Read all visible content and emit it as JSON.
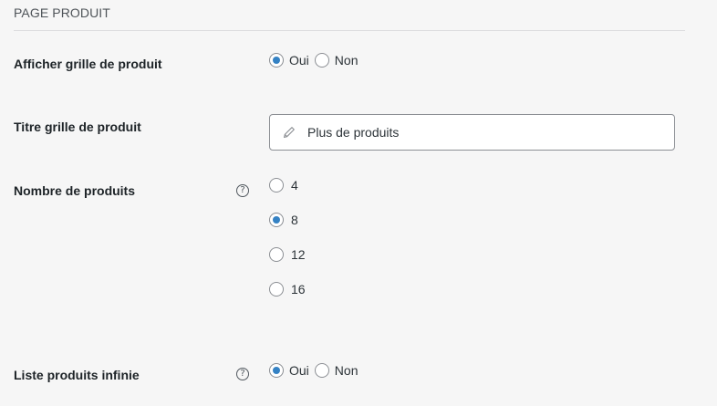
{
  "section": {
    "title": "PAGE PRODUIT"
  },
  "rows": {
    "show_grid": {
      "label": "Afficher grille de produit",
      "options": [
        "Oui",
        "Non"
      ],
      "selected": "Oui"
    },
    "grid_title": {
      "label": "Titre grille de produit",
      "value": "Plus de produits",
      "icon": "pencil-icon"
    },
    "product_count": {
      "label": "Nombre de produits",
      "help": "?",
      "options": [
        "4",
        "8",
        "12",
        "16"
      ],
      "selected": "8"
    },
    "infinite_list": {
      "label": "Liste produits infinie",
      "help": "?",
      "options": [
        "Oui",
        "Non"
      ],
      "selected": "Oui"
    }
  },
  "colors": {
    "background": "#f6f6f6",
    "radio_checked": "#3582c4",
    "border": "#8c8f94",
    "label_text": "#1d2327"
  }
}
